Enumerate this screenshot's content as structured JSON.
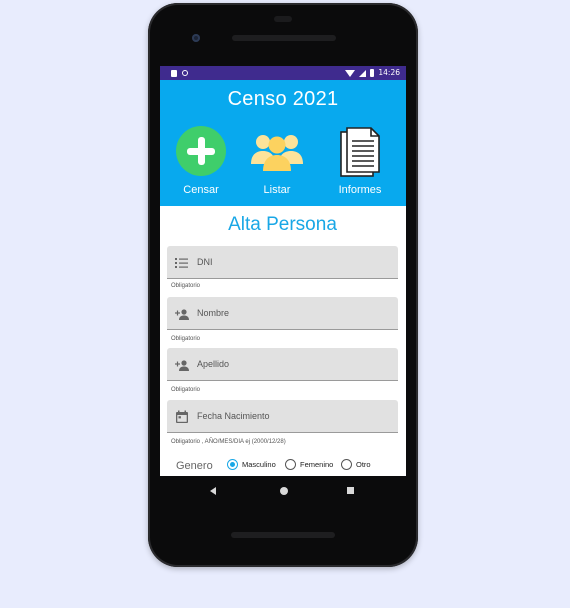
{
  "status_bar": {
    "time": "14:26"
  },
  "app": {
    "title": "Censo 2021"
  },
  "nav": {
    "censar": "Censar",
    "listar": "Listar",
    "informes": "Informes"
  },
  "form": {
    "title": "Alta Persona",
    "fields": [
      {
        "placeholder": "DNI",
        "helper": "Obligatorio"
      },
      {
        "placeholder": "Nombre",
        "helper": "Obligatorio"
      },
      {
        "placeholder": "Apellido",
        "helper": "Obligatorio"
      },
      {
        "placeholder": "Fecha Nacimiento",
        "helper": "Obligatorio , AÑO/MES/DIA ej (2000/12/28)"
      }
    ],
    "gender": {
      "label": "Genero",
      "options": [
        "Masculino",
        "Femenino",
        "Otro"
      ],
      "selected": "Masculino"
    }
  },
  "icons": {
    "censar": "add-circle-icon",
    "listar": "people-group-icon",
    "informes": "document-report-icon",
    "dni": "numbered-list-icon",
    "nombre": "person-add-icon",
    "apellido": "person-add-icon",
    "fecha": "calendar-icon"
  },
  "colors": {
    "header": "#08a9ee",
    "status_bar": "#3f2b8e",
    "accent": "#19a7e6",
    "censar_icon": "#3fce6b"
  }
}
